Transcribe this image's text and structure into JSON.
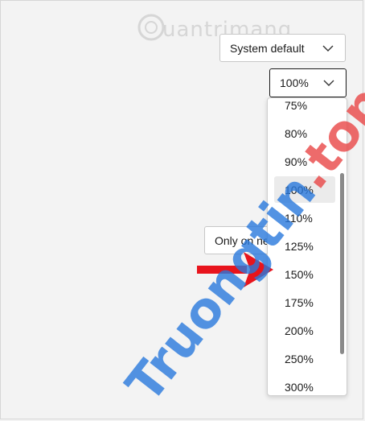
{
  "theme_select": {
    "value": "System default"
  },
  "zoom_select": {
    "value": "100%"
  },
  "only_select": {
    "value": "Only on new"
  },
  "zoom_options": [
    {
      "label": "75%",
      "selected": false
    },
    {
      "label": "80%",
      "selected": false
    },
    {
      "label": "90%",
      "selected": false
    },
    {
      "label": "100%",
      "selected": true
    },
    {
      "label": "110%",
      "selected": false
    },
    {
      "label": "125%",
      "selected": false
    },
    {
      "label": "150%",
      "selected": false
    },
    {
      "label": "175%",
      "selected": false
    },
    {
      "label": "200%",
      "selected": false
    },
    {
      "label": "250%",
      "selected": false
    },
    {
      "label": "300%",
      "selected": false
    }
  ],
  "watermark_top": "uantrimang",
  "watermark_big_a": "Truongtin",
  "watermark_big_b": ".top",
  "colors": {
    "arrow": "#e8141c",
    "selected_bg": "#ebebeb",
    "scrollbar": "#8a8a8a"
  },
  "icons": [
    "chevron-down-icon",
    "red-arrow-icon",
    "watermark-logo-icon"
  ]
}
